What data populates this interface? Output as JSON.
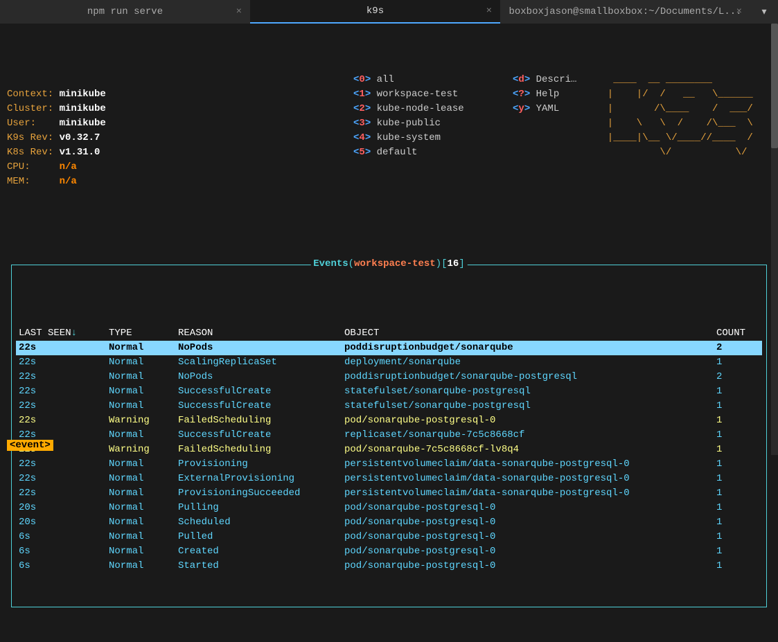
{
  "tabs": [
    {
      "label": "npm run serve",
      "active": false
    },
    {
      "label": "k9s",
      "active": true
    },
    {
      "label": "boxboxjason@smallboxbox:~/Documents/L...",
      "active": false
    }
  ],
  "info": {
    "context_k": "Context:",
    "context_v": "minikube",
    "cluster_k": "Cluster:",
    "cluster_v": "minikube",
    "user_k": "User:",
    "user_v": "minikube",
    "k9s_k": "K9s Rev:",
    "k9s_v": "v0.32.7",
    "k8s_k": "K8s Rev:",
    "k8s_v": "v1.31.0",
    "cpu_k": "CPU:",
    "cpu_v": "n/a",
    "mem_k": "MEM:",
    "mem_v": "n/a"
  },
  "hotkeys": [
    {
      "n": "0",
      "label": "all"
    },
    {
      "n": "1",
      "label": "workspace-test"
    },
    {
      "n": "2",
      "label": "kube-node-lease"
    },
    {
      "n": "3",
      "label": "kube-public"
    },
    {
      "n": "4",
      "label": "kube-system"
    },
    {
      "n": "5",
      "label": "default"
    }
  ],
  "cmds": [
    {
      "k": "d",
      "label": "Descri…"
    },
    {
      "k": "?",
      "label": "Help"
    },
    {
      "k": "y",
      "label": "YAML"
    }
  ],
  "ascii_logo": "   ____  __ ________\n  |    |/  /   __   \\______\n  |       /\\____    /  ___/\n  |    \\   \\  /    /\\___  \\\n  |____|\\__ \\/____//____  /\n           \\/           \\/",
  "events_header": {
    "title": "Events",
    "ns": "workspace-test",
    "count": "16"
  },
  "columns": {
    "last_seen": "LAST SEEN",
    "sort": "↓",
    "type": "TYPE",
    "reason": "REASON",
    "object": "OBJECT",
    "count": "COUNT"
  },
  "rows": [
    {
      "ls": "22s",
      "type": "Normal",
      "reason": "NoPods",
      "object": "poddisruptionbudget/sonarqube",
      "count": "2",
      "sel": true
    },
    {
      "ls": "22s",
      "type": "Normal",
      "reason": "ScalingReplicaSet",
      "object": "deployment/sonarqube",
      "count": "1"
    },
    {
      "ls": "22s",
      "type": "Normal",
      "reason": "NoPods",
      "object": "poddisruptionbudget/sonarqube-postgresql",
      "count": "2"
    },
    {
      "ls": "22s",
      "type": "Normal",
      "reason": "SuccessfulCreate",
      "object": "statefulset/sonarqube-postgresql",
      "count": "1"
    },
    {
      "ls": "22s",
      "type": "Normal",
      "reason": "SuccessfulCreate",
      "object": "statefulset/sonarqube-postgresql",
      "count": "1"
    },
    {
      "ls": "22s",
      "type": "Warning",
      "reason": "FailedScheduling",
      "object": "pod/sonarqube-postgresql-0",
      "count": "1",
      "warn": true
    },
    {
      "ls": "22s",
      "type": "Normal",
      "reason": "SuccessfulCreate",
      "object": "replicaset/sonarqube-7c5c8668cf",
      "count": "1"
    },
    {
      "ls": "22s",
      "type": "Warning",
      "reason": "FailedScheduling",
      "object": "pod/sonarqube-7c5c8668cf-lv8q4",
      "count": "1",
      "warn": true
    },
    {
      "ls": "22s",
      "type": "Normal",
      "reason": "Provisioning",
      "object": "persistentvolumeclaim/data-sonarqube-postgresql-0",
      "count": "1"
    },
    {
      "ls": "22s",
      "type": "Normal",
      "reason": "ExternalProvisioning",
      "object": "persistentvolumeclaim/data-sonarqube-postgresql-0",
      "count": "1"
    },
    {
      "ls": "22s",
      "type": "Normal",
      "reason": "ProvisioningSucceeded",
      "object": "persistentvolumeclaim/data-sonarqube-postgresql-0",
      "count": "1"
    },
    {
      "ls": "20s",
      "type": "Normal",
      "reason": "Pulling",
      "object": "pod/sonarqube-postgresql-0",
      "count": "1"
    },
    {
      "ls": "20s",
      "type": "Normal",
      "reason": "Scheduled",
      "object": "pod/sonarqube-postgresql-0",
      "count": "1"
    },
    {
      "ls": "6s",
      "type": "Normal",
      "reason": "Pulled",
      "object": "pod/sonarqube-postgresql-0",
      "count": "1"
    },
    {
      "ls": "6s",
      "type": "Normal",
      "reason": "Created",
      "object": "pod/sonarqube-postgresql-0",
      "count": "1"
    },
    {
      "ls": "6s",
      "type": "Normal",
      "reason": "Started",
      "object": "pod/sonarqube-postgresql-0",
      "count": "1"
    }
  ],
  "breadcrumb": "<event>"
}
